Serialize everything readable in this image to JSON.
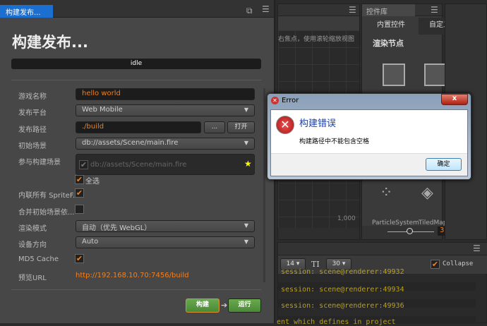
{
  "build_panel": {
    "tab": "构建发布...",
    "title": "构建发布...",
    "status": "idle",
    "fields": {
      "game_name_label": "游戏名称",
      "game_name": "hello world",
      "platform_label": "发布平台",
      "platform": "Web Mobile",
      "path_label": "发布路径",
      "path": "./build",
      "browse": "...",
      "open": "打开",
      "start_scene_label": "初始场景",
      "start_scene": "db://assets/Scene/main.fire",
      "scenes_label": "参与构建场景",
      "scene_item": "db://assets/Scene/main.fire",
      "select_all": "全选",
      "inline_label": "内联所有 SpriteF...",
      "merge_label": "合并初始场景依...",
      "render_label": "渲染模式",
      "render": "自动（优先 WebGL）",
      "orientation_label": "设备方向",
      "orientation": "Auto",
      "md5_label": "MD5 Cache",
      "preview_label": "预览URL",
      "preview_url": "http://192.168.10.70:7456/build"
    },
    "checks": {
      "scene_item": true,
      "select_all": true,
      "inline": true,
      "merge": false,
      "md5": true
    },
    "build": "构建",
    "run": "运行"
  },
  "scene": {
    "hint": "右焦点，使用滚轮缩放视图",
    "ruler": "1,000"
  },
  "library": {
    "tab": "控件库",
    "tabs": [
      "内置控件",
      "自定义控件"
    ],
    "section": "渲染节点",
    "items": [
      "ParticleSystem",
      "TiledMap"
    ],
    "zoom_value": "3"
  },
  "console": {
    "font_size": "14",
    "line_count": "30",
    "collapse": "Collapse",
    "lines": [
      "session: scene@renderer:49932",
      "session: scene@renderer:49934",
      "session: scene@renderer:49936",
      "ent which defines in project"
    ]
  },
  "dialog": {
    "title": "Error",
    "heading": "构建错误",
    "message": "构建路径中不能包含空格",
    "ok": "确定"
  },
  "colors": {
    "accent": "#f08020",
    "tab_active": "#1a6fd0",
    "build_green": "#5a9a40"
  }
}
